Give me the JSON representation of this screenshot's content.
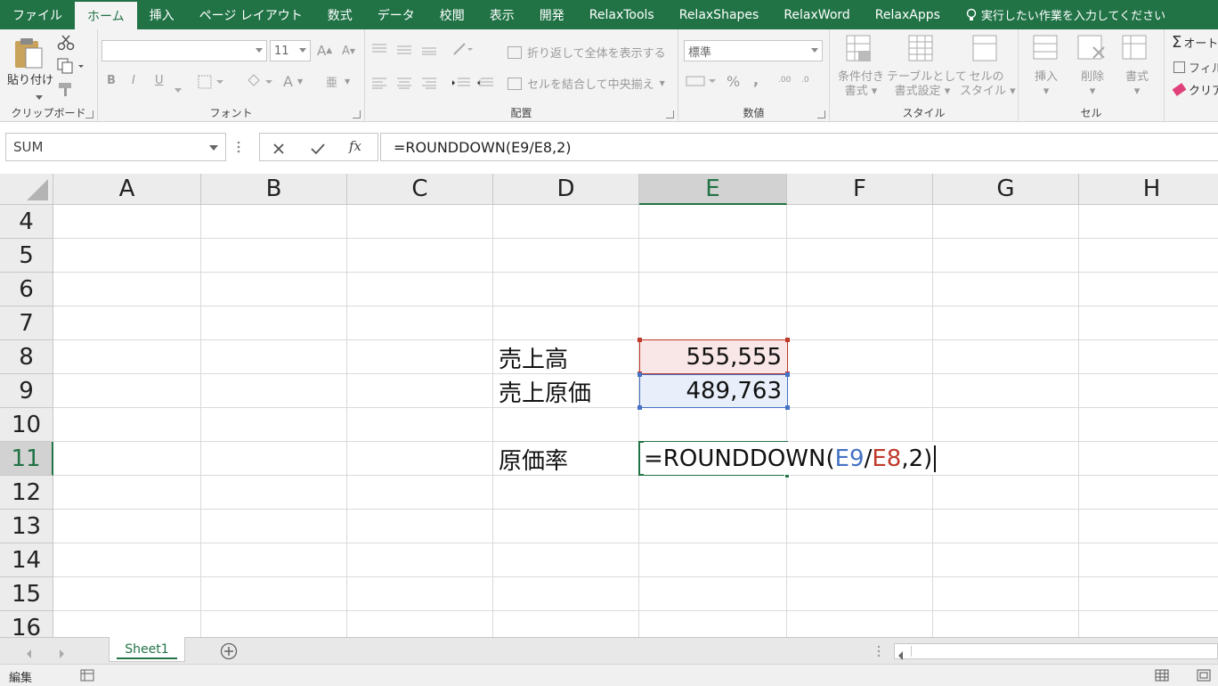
{
  "tabs": [
    "ファイル",
    "ホーム",
    "挿入",
    "ページ レイアウト",
    "数式",
    "データ",
    "校閲",
    "表示",
    "開発",
    "RelaxTools",
    "RelaxShapes",
    "RelaxWord",
    "RelaxApps"
  ],
  "active_tab_index": 1,
  "tell_me": "実行したい作業を入力してください",
  "ribbon": {
    "clipboard": {
      "paste_label": "貼り付け",
      "group_label": "クリップボード"
    },
    "font": {
      "font_name": "",
      "font_size": "11",
      "bold": "B",
      "italic": "I",
      "underline": "U",
      "font_color_glyph": "A",
      "phonetic_glyph": "亜",
      "grow_glyph": "A",
      "shrink_glyph": "A",
      "group_label": "フォント"
    },
    "alignment": {
      "wrap_text": "折り返して全体を表示する",
      "merge_center": "セルを結合して中央揃え",
      "group_label": "配置"
    },
    "number": {
      "format": "標準",
      "percent": "%",
      "comma": ",",
      "inc_decimal": ".00",
      "dec_decimal": ".0",
      "group_label": "数値"
    },
    "styles": {
      "conditional_format": [
        "条件付き",
        "書式"
      ],
      "format_as_table": [
        "テーブルとして",
        "書式設定"
      ],
      "cell_styles": [
        "セルの",
        "スタイル"
      ],
      "group_label": "スタイル"
    },
    "cells": {
      "insert": "挿入",
      "delete": "削除",
      "format": "書式",
      "group_label": "セル"
    },
    "editing": {
      "autosum": "オート",
      "fill": "フィル",
      "clear": "クリア"
    }
  },
  "name_box": "SUM",
  "formula_bar_text": "=ROUNDDOWN(E9/E8,2)",
  "fx_label": "fx",
  "columns": [
    "A",
    "B",
    "C",
    "D",
    "E",
    "F",
    "G",
    "H"
  ],
  "selected_column": "E",
  "rows": [
    "4",
    "5",
    "6",
    "7",
    "8",
    "9",
    "10",
    "11",
    "12",
    "13",
    "14",
    "15",
    "16"
  ],
  "selected_row": "11",
  "cells": {
    "D8": "売上高",
    "E8": "555,555",
    "D9": "売上原価",
    "E9": "489,763",
    "D11": "原価率",
    "E11_parts": {
      "prefix": "=ROUNDDOWN(",
      "ref1": "E9",
      "sep": "/",
      "ref2": "E8",
      "suffix": ",2)"
    }
  },
  "colors": {
    "accent": "#217346",
    "ref_blue": "#4472c4",
    "ref_red": "#c0392b",
    "ref_blue_fill": "#e8effa",
    "ref_red_fill": "#f9e6e6"
  },
  "sheet_tab": "Sheet1",
  "status_mode": "編集"
}
